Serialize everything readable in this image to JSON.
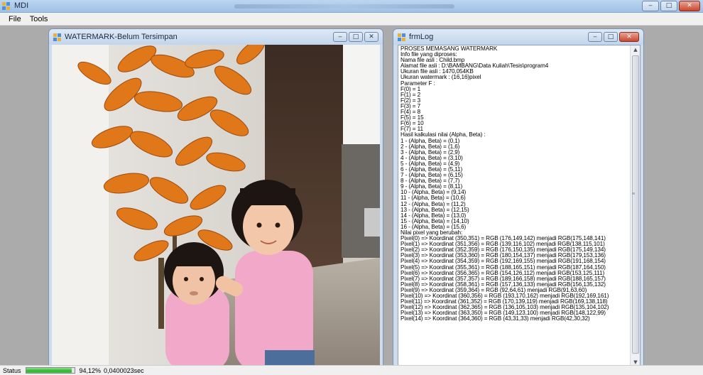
{
  "app": {
    "title": "MDI",
    "title_blurred_text": "Sertifikasi Hak Cipta Watermark Aplikasi Fotografi",
    "controls": [
      "minimize",
      "maximize",
      "close"
    ]
  },
  "menu": {
    "items": [
      "File",
      "Tools"
    ]
  },
  "watermark_window": {
    "title": "WATERMARK-Belum Tersimpan",
    "image_content": "photo of two young girls in pink shirts posing in front of a large orange-leafed plant"
  },
  "log_window": {
    "title": "frmLog",
    "lines": [
      "PROSES MEMASANG WATERMARK",
      "Info file yang diproses:",
      "Nama file asli : Child.bmp",
      "Alamat file asli : D:\\BAMBANG\\Data Kuliah\\Tesis\\program4",
      "Ukuran file asli : 1470,054KB",
      "Ukuran watermark : (16,16)pixel",
      "Parameter F :",
      "F(0) = 1",
      "F(1) = 2",
      "F(2) = 3",
      "F(3) = 7",
      "F(4) = 8",
      "F(5) = 15",
      "F(6) = 10",
      "F(7) = 11",
      "Hasil kalkulasi nilai (Alpha, Beta) :",
      "1 - (Alpha, Beta) = (0,1)",
      "2 - (Alpha, Beta) = (1,6)",
      "3 - (Alpha, Beta) = (2,9)",
      "4 - (Alpha, Beta) = (3,10)",
      "5 - (Alpha, Beta) = (4,9)",
      "6 - (Alpha, Beta) = (5,11)",
      "7 - (Alpha, Beta) = (6,15)",
      "8 - (Alpha, Beta) = (7,7)",
      "9 - (Alpha, Beta) = (8,11)",
      "10 - (Alpha, Beta) = (9,14)",
      "11 - (Alpha, Beta) = (10,6)",
      "12 - (Alpha, Beta) = (11,2)",
      "13 - (Alpha, Beta) = (12,15)",
      "14 - (Alpha, Beta) = (13,0)",
      "15 - (Alpha, Beta) = (14,10)",
      "16 - (Alpha, Beta) = (15,6)",
      "Nilai pixel yang berubah:",
      "Pixel(0) => Koordinat (350,351) = RGB (176,149,142) menjadi RGB(175,148,141)",
      "Pixel(1) => Koordinat (351,356) = RGB (139,116,102) menjadi RGB(138,115,101)",
      "Pixel(2) => Koordinat (352,359) = RGB (176,150,135) menjadi RGB(175,149,134)",
      "Pixel(3) => Koordinat (353,360) = RGB (180,154,137) menjadi RGB(179,153,136)",
      "Pixel(4) => Koordinat (354,359) = RGB (192,169,155) menjadi RGB(191,168,154)",
      "Pixel(5) => Koordinat (355,361) = RGB (188,165,151) menjadi RGB(187,164,150)",
      "Pixel(6) => Koordinat (356,365) = RGB (154,126,112) menjadi RGB(153,125,111)",
      "Pixel(7) => Koordinat (357,357) = RGB (189,166,158) menjadi RGB(188,165,157)",
      "Pixel(8) => Koordinat (358,361) = RGB (157,136,133) menjadi RGB(156,135,132)",
      "Pixel(9) => Koordinat (359,364) = RGB (92,64,61) menjadi RGB(91,63,60)",
      "Pixel(10) => Koordinat (360,356) = RGB (193,170,162) menjadi RGB(192,169,161)",
      "Pixel(11) => Koordinat (361,352) = RGB (170,139,119) menjadi RGB(169,138,118)",
      "Pixel(12) => Koordinat (362,365) = RGB (136,105,103) menjadi RGB(135,104,102)",
      "Pixel(13) => Koordinat (363,350) = RGB (149,123,100) menjadi RGB(148,122,99)",
      "Pixel(14) => Koordinat (364,360) = RGB (43,31,33) menjadi RGB(42,30,32)"
    ]
  },
  "status": {
    "label": "Status",
    "progress_percent": 94.12,
    "progress_text": "94,12%",
    "time_text": "0,0400023sec"
  },
  "colors": {
    "progress_fill": "#2fb42f",
    "leaf_orange": "#e07a1c",
    "shirt_pink": "#f2a9c9"
  }
}
